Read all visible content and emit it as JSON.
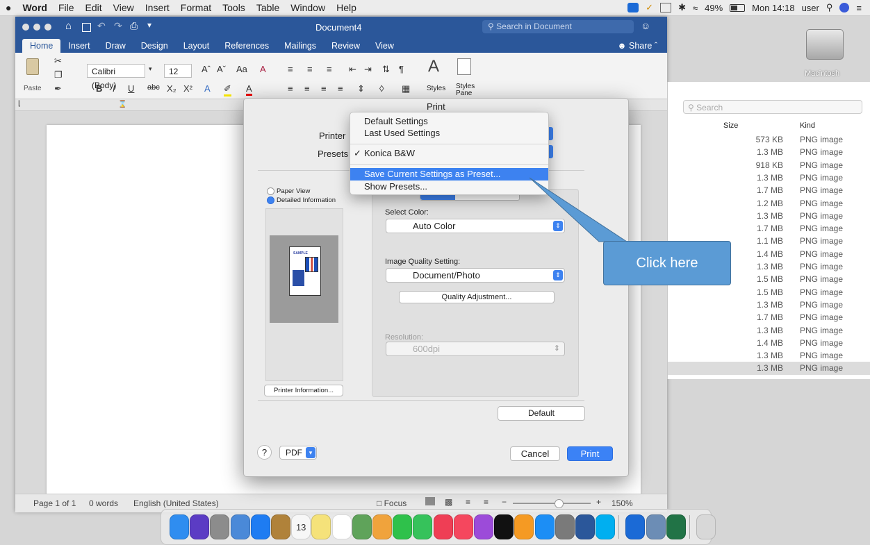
{
  "menubar": {
    "apple": "",
    "app_name": "Word",
    "items": [
      "File",
      "Edit",
      "View",
      "Insert",
      "Format",
      "Tools",
      "Table",
      "Window",
      "Help"
    ],
    "battery": "49%",
    "clock": "Mon 14:18",
    "user": "user"
  },
  "word": {
    "doc_title": "Document4",
    "search_placeholder": "Search in Document",
    "share_label": "Share",
    "tabs": [
      "Home",
      "Insert",
      "Draw",
      "Design",
      "Layout",
      "References",
      "Mailings",
      "Review",
      "View"
    ],
    "ribbon": {
      "paste": "Paste",
      "font_name": "Calibri (Body)",
      "font_size": "12",
      "styles": "Styles",
      "styles_pane": "Styles Pane"
    },
    "status": {
      "page": "Page 1 of 1",
      "words": "0 words",
      "language": "English (United States)",
      "focus": "Focus",
      "zoom": "150%"
    }
  },
  "finder": {
    "disk_label": "Macintosh",
    "search_placeholder": "Search",
    "col_size": "Size",
    "col_kind": "Kind",
    "rows": [
      {
        "size": "573 KB",
        "kind": "PNG image"
      },
      {
        "size": "1.3 MB",
        "kind": "PNG image"
      },
      {
        "size": "918 KB",
        "kind": "PNG image"
      },
      {
        "size": "1.3 MB",
        "kind": "PNG image"
      },
      {
        "size": "1.7 MB",
        "kind": "PNG image"
      },
      {
        "size": "1.2 MB",
        "kind": "PNG image"
      },
      {
        "size": "1.3 MB",
        "kind": "PNG image"
      },
      {
        "size": "1.7 MB",
        "kind": "PNG image"
      },
      {
        "size": "1.1 MB",
        "kind": "PNG image"
      },
      {
        "size": "1.4 MB",
        "kind": "PNG image"
      },
      {
        "size": "1.3 MB",
        "kind": "PNG image"
      },
      {
        "size": "1.5 MB",
        "kind": "PNG image"
      },
      {
        "size": "1.5 MB",
        "kind": "PNG image"
      },
      {
        "size": "1.3 MB",
        "kind": "PNG image"
      },
      {
        "size": "1.7 MB",
        "kind": "PNG image"
      },
      {
        "size": "1.3 MB",
        "kind": "PNG image"
      },
      {
        "size": "1.4 MB",
        "kind": "PNG image"
      },
      {
        "size": "1.3 MB",
        "kind": "PNG image"
      },
      {
        "size": "1.3 MB",
        "kind": "PNG image"
      }
    ]
  },
  "print_dialog": {
    "title": "Print",
    "printer_label": "Printer",
    "presets_label": "Presets",
    "paper_view": "Paper View",
    "detailed_info": "Detailed Information",
    "printer_info_button": "Printer Information...",
    "select_color_label": "Select Color:",
    "select_color_value": "Auto Color",
    "image_quality_label": "Image Quality Setting:",
    "image_quality_value": "Document/Photo",
    "quality_adjust_button": "Quality Adjustment...",
    "resolution_label": "Resolution:",
    "resolution_value": "600dpi",
    "default_button": "Default",
    "help": "?",
    "pdf_button": "PDF",
    "cancel_button": "Cancel",
    "print_button": "Print",
    "thumb_label": "SAMPLE"
  },
  "preset_menu": {
    "items": [
      "Default Settings",
      "Last Used Settings",
      "Konica B&W",
      "Save Current Settings as Preset...",
      "Show Presets..."
    ],
    "checked": "Konica B&W",
    "highlighted": "Save Current Settings as Preset..."
  },
  "callout": {
    "text": "Click here"
  },
  "colors": {
    "word_blue": "#2b579a",
    "highlight": "#3d82f0",
    "callout": "#5b9bd5",
    "print_blue": "#3b82f6"
  },
  "dock_apps": [
    "finder-icon",
    "siri-icon",
    "launchpad-icon",
    "preview-icon",
    "safari-icon",
    "contacts-icon",
    "calendar-icon",
    "notes-icon",
    "reminders-icon",
    "maps-icon",
    "photos-icon",
    "messages-icon",
    "facetime-icon",
    "news-icon",
    "music-icon",
    "podcasts-icon",
    "tv-icon",
    "books-icon",
    "app-store-icon",
    "system-preferences-icon",
    "word-icon",
    "skype-icon",
    "teamviewer-icon",
    "image-capture-icon",
    "excel-icon",
    "trash-icon"
  ],
  "dock_calendar_day": "13"
}
